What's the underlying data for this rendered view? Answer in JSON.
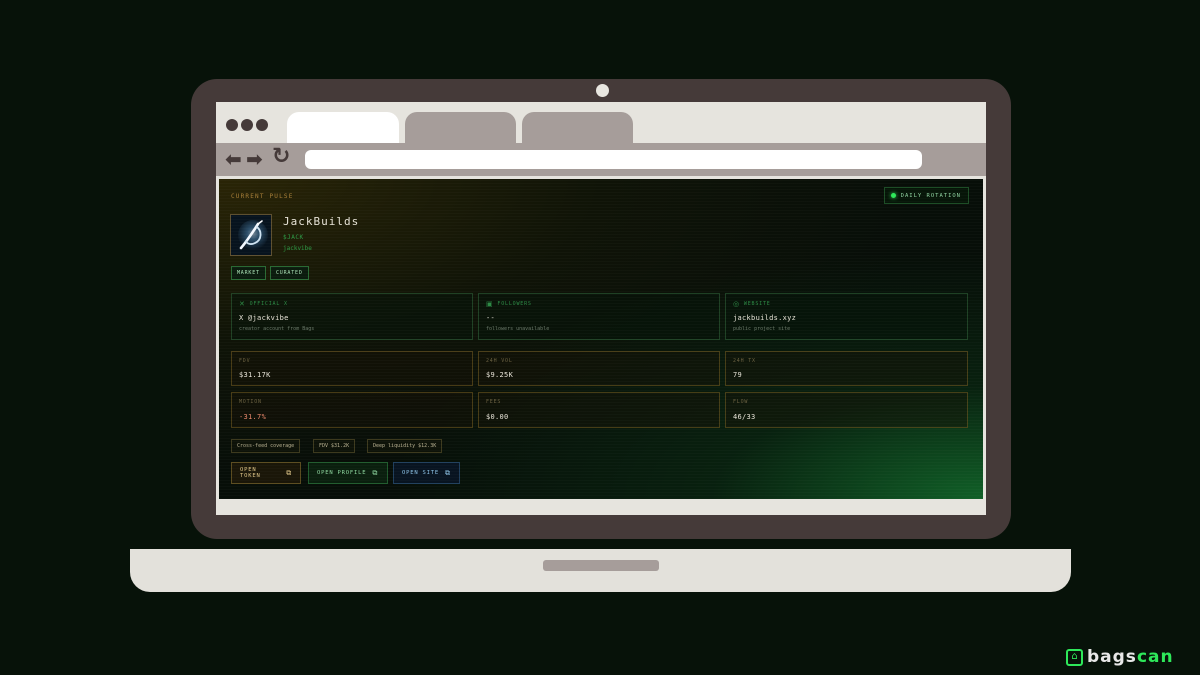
{
  "browser": {
    "back_icon": "arrow-left-icon",
    "forward_icon": "arrow-right-icon",
    "reload_icon": "reload-icon"
  },
  "page": {
    "section_label": "CURRENT PULSE",
    "rotation_badge": "DAILY ROTATION",
    "token": {
      "name": "JackBuilds",
      "ticker": "$JACK",
      "handle": "jackvibe"
    },
    "tags": [
      "MARKET",
      "CURATED"
    ],
    "info_cards": [
      {
        "label": "OFFICIAL X",
        "icon": "x-logo-icon",
        "value": "X @jackvibe",
        "sub": "creator account from Bags"
      },
      {
        "label": "FOLLOWERS",
        "icon": "users-icon",
        "value": "--",
        "sub": "followers unavailable"
      },
      {
        "label": "WEBSITE",
        "icon": "globe-icon",
        "value": "jackbuilds.xyz",
        "sub": "public project site"
      }
    ],
    "stats": [
      {
        "label": "FDV",
        "value": "$31.17K"
      },
      {
        "label": "24H VOL",
        "value": "$9.25K"
      },
      {
        "label": "24H TX",
        "value": "79"
      },
      {
        "label": "MOTION",
        "value": "-31.7%"
      },
      {
        "label": "FEES",
        "value": "$0.00"
      },
      {
        "label": "FLOW",
        "value": "46/33"
      }
    ],
    "chips": [
      "Cross-feed coverage",
      "FDV $31.2K",
      "Deep liquidity $12.3K"
    ],
    "buttons": {
      "open_token": "OPEN TOKEN",
      "open_profile": "OPEN PROFILE",
      "open_site": "OPEN SITE"
    }
  },
  "logo": {
    "prefix": "bags",
    "suffix": "can"
  },
  "colors": {
    "accent_green": "#2ee85a",
    "gold": "#a87f38",
    "negative": "#e8866a",
    "laptop": "#453a39"
  }
}
